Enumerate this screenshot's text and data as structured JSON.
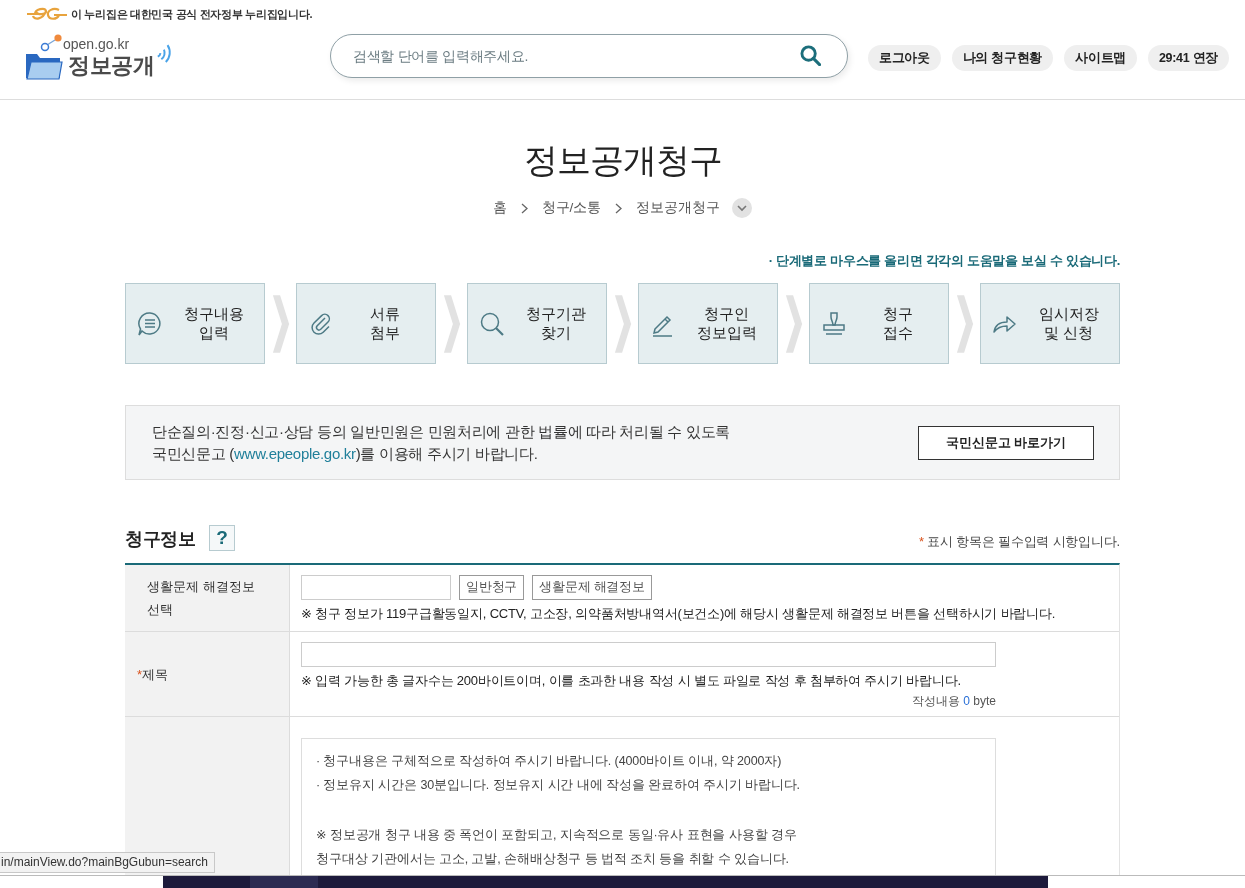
{
  "gov_banner": {
    "text": "이 누리집은 대한민국 공식 전자정부 누리집입니다."
  },
  "header": {
    "logo": {
      "domain": "open.go.kr",
      "name": "정보공개"
    },
    "search": {
      "placeholder": "검색할 단어를 입력해주세요."
    },
    "buttons": [
      "로그아웃",
      "나의 청구현황",
      "사이트맵",
      "29:41 연장"
    ]
  },
  "page": {
    "title": "정보공개청구",
    "breadcrumb": [
      "홈",
      "청구/소통",
      "정보공개청구"
    ]
  },
  "steps": {
    "hint": "· 단계별로 마우스를 올리면 각각의 도움말을 보실 수 있습니다.",
    "items": [
      {
        "kind": "speech",
        "lines": [
          "청구내용",
          "입력"
        ]
      },
      {
        "kind": "clip",
        "lines": [
          "서류",
          "첨부"
        ]
      },
      {
        "kind": "search",
        "lines": [
          "청구기관",
          "찾기"
        ]
      },
      {
        "kind": "pencil",
        "lines": [
          "청구인",
          "정보입력"
        ]
      },
      {
        "kind": "stamp",
        "lines": [
          "청구",
          "접수"
        ]
      },
      {
        "kind": "share",
        "lines": [
          "임시저장",
          "및 신청"
        ]
      }
    ]
  },
  "notice": {
    "line_1": "단순질의·진정·신고·상담 등의 일반민원은 민원처리에 관한 법률에 따라 처리될 수 있도록",
    "line_2_before": "국민신문고 (",
    "link": "www.epeople.go.kr",
    "line_2_after": ")를 이용해 주시기 바랍니다.",
    "button": "국민신문고 바로가기"
  },
  "section": {
    "title": "청구정보",
    "help_button": "?",
    "required_mark": "*",
    "required_note": "표시 항목은 필수입력 시항입니다."
  },
  "form_rows": [
    {
      "kind": "choice",
      "label_lines": [
        "생활문제 해결정보",
        "선택"
      ],
      "buttons": [
        "일반청구",
        "생활문제 해결정보"
      ],
      "note": "※ 청구 정보가 119구급활동일지, CCTV, 고소장, 의약품처방내역서(보건소)에 해당시 생활문제 해결정보 버튼을 선택하시기 바랍니다."
    },
    {
      "kind": "text",
      "required_mark": "*",
      "label_lines": [
        "제목"
      ],
      "note": "※ 입력 가능한 총 글자수는 200바이트이며, 이를 초과한 내용 작성 시 별도 파일로 작성 후 첨부하여 주시기 바랍니다.",
      "counter": {
        "label": "작성내용",
        "count": "0",
        "unit": "byte"
      }
    },
    {
      "kind": "textarea",
      "paragraphs": [
        [
          "· 청구내용은 구체적으로 작성하여 주시기 바랍니다. (4000바이트 이내, 약 2000자)",
          "· 정보유지 시간은 30분입니다. 정보유지 시간 내에 작성을 완료하여 주시기 바랍니다."
        ],
        [
          "※ 정보공개 청구 내용 중 폭언이 포함되고, 지속적으로 동일·유사 표현을 사용할 경우",
          "청구대상 기관에서는 고소, 고발, 손해배상청구 등 법적 조치 등을 취할 수 있습니다."
        ]
      ]
    }
  ],
  "status_bar": {
    "url": "in/mainView.do?mainBgGubun=search"
  }
}
